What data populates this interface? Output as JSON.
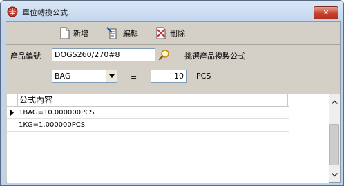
{
  "window": {
    "title": "單位轉換公式",
    "close_label": "✕"
  },
  "toolbar": {
    "new_label": "新增",
    "edit_label": "編輯",
    "delete_label": "刪除"
  },
  "form": {
    "product_code_label": "產品編號",
    "product_code_value": "DOGS260/270#8",
    "copy_formula_label": "挑選產品複製公式",
    "unit_value": "BAG",
    "equals_label": "=",
    "quantity_value": "10",
    "target_unit_label": "PCS"
  },
  "grid": {
    "column_header": "公式內容",
    "rows": [
      {
        "text": "1BAG=10.000000PCS"
      },
      {
        "text": "1KG=1.000000PCS"
      }
    ]
  }
}
